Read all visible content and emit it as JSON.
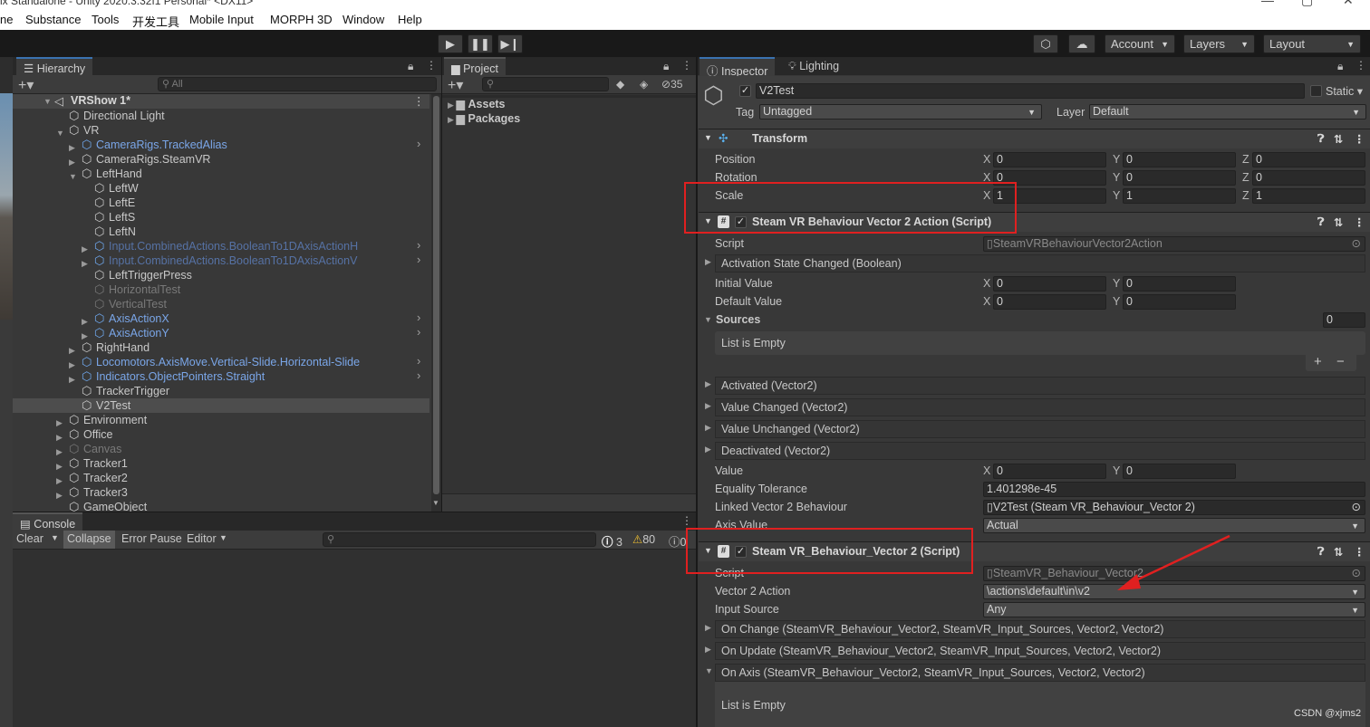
{
  "window": {
    "title": "ix Standalone - Unity 2020.3.32f1 Personal* <DX11>"
  },
  "menu": [
    "ne",
    "Substance",
    "Tools",
    "开发工具",
    "Mobile Input",
    "MORPH 3D",
    "Window",
    "Help"
  ],
  "toolbar": {
    "account": "Account",
    "layers": "Layers",
    "layout": "Layout"
  },
  "hierarchy": {
    "tab": "Hierarchy",
    "search_placeholder": "All",
    "scene": "VRShow 1*",
    "items": [
      {
        "label": "Directional Light",
        "style": "normal",
        "depth": 1,
        "fold": ""
      },
      {
        "label": "VR",
        "style": "normal",
        "depth": 1,
        "fold": "open"
      },
      {
        "label": "CameraRigs.TrackedAlias",
        "style": "prefab",
        "depth": 2,
        "fold": "closed",
        "arrow": true
      },
      {
        "label": "CameraRigs.SteamVR",
        "style": "normal",
        "depth": 2,
        "fold": "closed"
      },
      {
        "label": "LeftHand",
        "style": "normal",
        "depth": 2,
        "fold": "open"
      },
      {
        "label": "LeftW",
        "style": "normal",
        "depth": 3,
        "fold": ""
      },
      {
        "label": "LeftE",
        "style": "normal",
        "depth": 3,
        "fold": ""
      },
      {
        "label": "LeftS",
        "style": "normal",
        "depth": 3,
        "fold": ""
      },
      {
        "label": "LeftN",
        "style": "normal",
        "depth": 3,
        "fold": ""
      },
      {
        "label": "Input.CombinedActions.BooleanTo1DAxisActionH",
        "style": "prefabdim",
        "depth": 3,
        "fold": "closed",
        "arrow": true
      },
      {
        "label": "Input.CombinedActions.BooleanTo1DAxisActionV",
        "style": "prefabdim",
        "depth": 3,
        "fold": "closed",
        "arrow": true
      },
      {
        "label": "LeftTriggerPress",
        "style": "normal",
        "depth": 3,
        "fold": ""
      },
      {
        "label": "HorizontalTest",
        "style": "dim",
        "depth": 3,
        "fold": ""
      },
      {
        "label": "VerticalTest",
        "style": "dim",
        "depth": 3,
        "fold": ""
      },
      {
        "label": "AxisActionX",
        "style": "prefab",
        "depth": 3,
        "fold": "closed",
        "arrow": true
      },
      {
        "label": "AxisActionY",
        "style": "prefab",
        "depth": 3,
        "fold": "closed",
        "arrow": true
      },
      {
        "label": "RightHand",
        "style": "normal",
        "depth": 2,
        "fold": "closed"
      },
      {
        "label": "Locomotors.AxisMove.Vertical-Slide.Horizontal-Slide",
        "style": "prefab",
        "depth": 2,
        "fold": "closed",
        "arrow": true
      },
      {
        "label": "Indicators.ObjectPointers.Straight",
        "style": "prefab",
        "depth": 2,
        "fold": "closed",
        "arrow": true
      },
      {
        "label": "TrackerTrigger",
        "style": "normal",
        "depth": 2,
        "fold": ""
      },
      {
        "label": "V2Test",
        "style": "selected",
        "depth": 2,
        "fold": ""
      },
      {
        "label": "Environment",
        "style": "normal",
        "depth": 1,
        "fold": "closed"
      },
      {
        "label": "Office",
        "style": "normal",
        "depth": 1,
        "fold": "closed"
      },
      {
        "label": "Canvas",
        "style": "dim",
        "depth": 1,
        "fold": "closed"
      },
      {
        "label": "Tracker1",
        "style": "normal",
        "depth": 1,
        "fold": "closed"
      },
      {
        "label": "Tracker2",
        "style": "normal",
        "depth": 1,
        "fold": "closed"
      },
      {
        "label": "Tracker3",
        "style": "normal",
        "depth": 1,
        "fold": "closed"
      },
      {
        "label": "GameObject",
        "style": "normal",
        "depth": 1,
        "fold": ""
      }
    ]
  },
  "project": {
    "tab": "Project",
    "hidden_count": "35",
    "folders": [
      "Assets",
      "Packages"
    ]
  },
  "console": {
    "tab": "Console",
    "clear": "Clear",
    "collapse": "Collapse",
    "error_pause": "Error Pause",
    "editor": "Editor",
    "info_count": "3",
    "warn_count": "80",
    "error_count": "0"
  },
  "inspector": {
    "tab": "Inspector",
    "lighting_tab": "Lighting",
    "object_name": "V2Test",
    "static_label": "Static",
    "tag_label": "Tag",
    "tag_value": "Untagged",
    "layer_label": "Layer",
    "layer_value": "Default",
    "transform": {
      "title": "Transform",
      "position_label": "Position",
      "rotation_label": "Rotation",
      "scale_label": "Scale",
      "position": [
        "0",
        "0",
        "0"
      ],
      "rotation": [
        "0",
        "0",
        "0"
      ],
      "scale": [
        "1",
        "1",
        "1"
      ]
    },
    "comp1": {
      "title": "Steam VR Behaviour Vector 2 Action (Script)",
      "script_label": "Script",
      "script_value": "SteamVRBehaviourVector2Action",
      "activation_event": "Activation State Changed (Boolean)",
      "initial_label": "Initial Value",
      "initial": [
        "0",
        "0"
      ],
      "default_label": "Default Value",
      "default": [
        "0",
        "0"
      ],
      "sources_label": "Sources",
      "sources_count": "0",
      "list_empty": "List is Empty",
      "events": [
        "Activated (Vector2)",
        "Value Changed (Vector2)",
        "Value Unchanged (Vector2)",
        "Deactivated (Vector2)"
      ],
      "value_label": "Value",
      "value": [
        "0",
        "0"
      ],
      "tolerance_label": "Equality Tolerance",
      "tolerance": "1.401298e-45",
      "linked_label": "Linked Vector 2 Behaviour",
      "linked_value": "V2Test (Steam VR_Behaviour_Vector 2)",
      "axis_label": "Axis Value",
      "axis_value": "Actual"
    },
    "comp2": {
      "title": "Steam VR_Behaviour_Vector 2 (Script)",
      "script_label": "Script",
      "script_value": "SteamVR_Behaviour_Vector2",
      "action_label": "Vector 2 Action",
      "action_value": "\\actions\\default\\in\\v2",
      "input_label": "Input Source",
      "input_value": "Any",
      "events": [
        "On Change (SteamVR_Behaviour_Vector2, SteamVR_Input_Sources, Vector2, Vector2)",
        "On Update (SteamVR_Behaviour_Vector2, SteamVR_Input_Sources, Vector2, Vector2)",
        "On Axis (SteamVR_Behaviour_Vector2, SteamVR_Input_Sources, Vector2, Vector2)"
      ],
      "list_empty": "List is Empty"
    }
  },
  "watermark": "CSDN @xjms2"
}
